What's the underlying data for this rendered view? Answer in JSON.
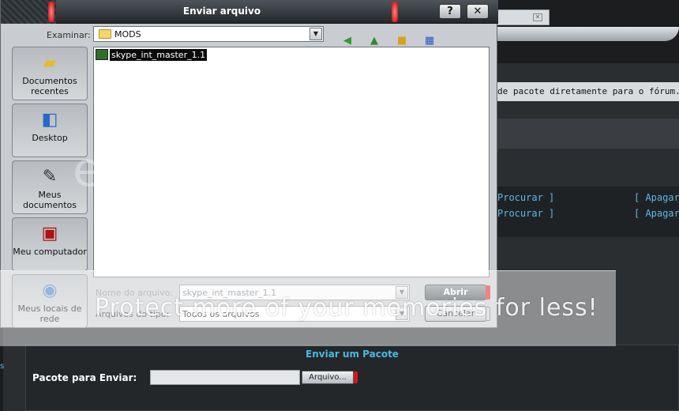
{
  "dialog": {
    "title": "Enviar arquivo",
    "help_label": "?",
    "close_label": "✕",
    "lookin_label": "Examinar:",
    "lookin_value": "MODS",
    "places": [
      {
        "label": "Documentos recentes",
        "icon": "recent-documents-icon"
      },
      {
        "label": "Desktop",
        "icon": "desktop-icon"
      },
      {
        "label": "Meus documentos",
        "icon": "my-documents-icon"
      },
      {
        "label": "Meu computador",
        "icon": "my-computer-icon"
      },
      {
        "label": "Meus locais de rede",
        "icon": "network-places-icon"
      }
    ],
    "files": [
      {
        "name": "skype_int_master_1.1",
        "selected": true
      }
    ],
    "filename_label": "Nome do arquivo:",
    "filename_value": "skype_int_master_1.1",
    "filetype_label": "Arquivos do tipo:",
    "filetype_value": "Todos os arquivos",
    "open_label": "Abrir",
    "cancel_label": "Cancelar"
  },
  "page": {
    "strip_text": "de pacote diretamente para o fórum.",
    "links": [
      {
        "search": "Procurar ]",
        "delete": "[ Apagar"
      },
      {
        "search": "Procurar ]",
        "delete": "[ Apagar"
      }
    ],
    "upload_title": "Enviar um Pacote",
    "upload_label": "Pacote para Enviar:",
    "browse_label": "Arquivo...",
    "side_text": "s"
  },
  "watermark": {
    "text": "Protect more of your memories for less!",
    "logo": "et"
  },
  "colors": {
    "accent_red": "#e41f1f",
    "link_blue": "#5ab9e3",
    "selection": "#0a0a0a"
  }
}
